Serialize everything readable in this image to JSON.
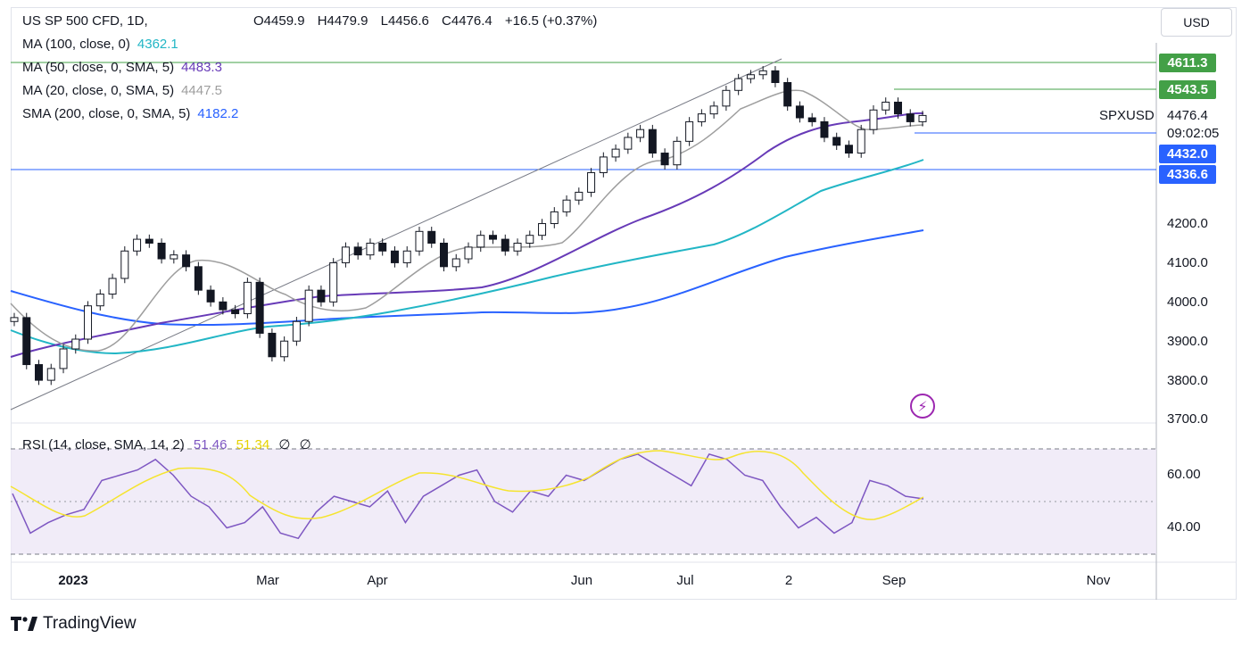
{
  "header": {
    "symbol_line": "US SP 500 CFD, 1D,",
    "ohlc": {
      "open": "O4459.9",
      "high": "H4479.9",
      "low": "L4456.6",
      "close": "C4476.4",
      "change": "+16.5 (+0.37%)"
    },
    "currency": "USD"
  },
  "indicators": [
    {
      "label": "MA (100, close, 0)",
      "value": "4362.1",
      "color": "#22b6c5"
    },
    {
      "label": "MA (50, close, 0, SMA, 5)",
      "value": "4483.3",
      "color": "#673ab7"
    },
    {
      "label": "MA (20, close, 0, SMA, 5)",
      "value": "4447.5",
      "color": "#9e9e9e"
    },
    {
      "label": "SMA (200, close, 0, SMA, 5)",
      "value": "4182.2",
      "color": "#2962ff"
    }
  ],
  "price_tags": [
    {
      "text": "4611.3",
      "color": "#43a047"
    },
    {
      "text": "4543.5",
      "color": "#43a047"
    },
    {
      "text": "4432.0",
      "color": "#2962ff"
    },
    {
      "text": "4336.6",
      "color": "#2962ff"
    }
  ],
  "symbol_label": "SPXUSD",
  "last_price": "4476.4",
  "countdown": "09:02:05",
  "rsi": {
    "label": "RSI (14, close, SMA, 14, 2)",
    "value": "51.46",
    "sma": "51.34",
    "extra1": "∅",
    "extra2": "∅"
  },
  "price_axis": [
    "4200.0",
    "4100.0",
    "4000.0",
    "3900.0",
    "3800.0",
    "3700.0"
  ],
  "rsi_axis": [
    "60.00",
    "40.00"
  ],
  "x_axis": [
    "2023",
    "Mar",
    "Apr",
    "Jun",
    "Jul",
    "2",
    "Sep",
    "Nov"
  ],
  "brand": "TradingView",
  "chart_data": {
    "type": "line",
    "title": "US SP 500 CFD, 1D",
    "ylim": [
      3700,
      4640
    ],
    "price_close": [
      3960,
      3840,
      3800,
      3830,
      3880,
      3905,
      3990,
      4020,
      4060,
      4130,
      4160,
      4150,
      4110,
      4120,
      4090,
      4030,
      4000,
      3980,
      3970,
      4050,
      3920,
      3860,
      3900,
      3950,
      4030,
      4000,
      4100,
      4140,
      4120,
      4150,
      4130,
      4100,
      4130,
      4180,
      4150,
      4090,
      4110,
      4140,
      4170,
      4160,
      4130,
      4150,
      4170,
      4200,
      4230,
      4260,
      4280,
      4330,
      4370,
      4390,
      4420,
      4440,
      4380,
      4350,
      4410,
      4460,
      4480,
      4500,
      4540,
      4570,
      4580,
      4590,
      4560,
      4500,
      4470,
      4460,
      4420,
      4400,
      4380,
      4440,
      4490,
      4510,
      4480,
      4460,
      4476
    ],
    "rsi": [
      53,
      38,
      42,
      45,
      47,
      58,
      60,
      62,
      66,
      60,
      52,
      48,
      40,
      42,
      48,
      38,
      36,
      46,
      52,
      50,
      48,
      54,
      42,
      52,
      56,
      60,
      62,
      50,
      46,
      54,
      52,
      60,
      58,
      62,
      66,
      68,
      64,
      60,
      56,
      68,
      66,
      60,
      58,
      48,
      40,
      44,
      38,
      42,
      58,
      56,
      52,
      51
    ],
    "overbought": 70,
    "oversold": 30,
    "price_lines": [
      4611.3,
      4543.5,
      4432.0,
      4336.6
    ],
    "series": [
      {
        "name": "MA (100, close, 0)",
        "last": 4362.1
      },
      {
        "name": "MA (50, close, 0, SMA, 5)",
        "last": 4483.3
      },
      {
        "name": "MA (20, close, 0, SMA, 5)",
        "last": 4447.5
      },
      {
        "name": "SMA (200, close, 0, SMA, 5)",
        "last": 4182.2
      }
    ]
  }
}
